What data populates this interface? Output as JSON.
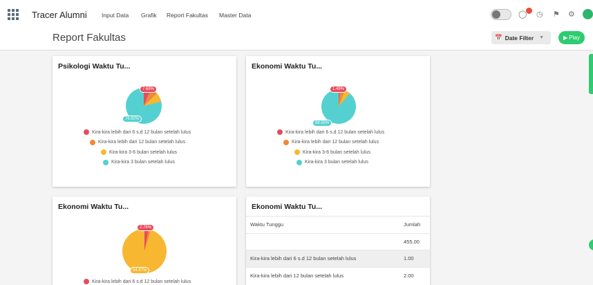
{
  "app": {
    "title": "Tracer Alumni",
    "nav": [
      "Input Data",
      "Grafik",
      "Report Fakultas",
      "Master Data"
    ]
  },
  "page": {
    "title": "Report Fakultas",
    "date_filter": "Date Filter",
    "play": "Play"
  },
  "legend": [
    {
      "label": "Kira-kira lebih dari 6 s.d 12 bulan setelah lulus",
      "color": "#e74c5c"
    },
    {
      "label": "Kira-kira lebih dari 12 bulan setelah lulus",
      "color": "#f0883a"
    },
    {
      "label": "Kira-kira 3-6 bulan setelah lulus",
      "color": "#f7b731"
    },
    {
      "label": "Kira-kira 3 bulan setelah  lulus",
      "color": "#55d0d0"
    }
  ],
  "cards": [
    {
      "title": "Psikologi Waktu Tu...",
      "top_pct": "7.69%",
      "main_pct": "76.92%"
    },
    {
      "title": "Ekonomi Waktu Tu...",
      "top_pct": "1.49%",
      "main_pct": "89.55%"
    },
    {
      "title": "Ekonomi Waktu Tu...",
      "top_pct": "2.76%",
      "main_pct": "94.47%",
      "legend_partial": "Kira-kira lebih dari 6 s.d 12 bulan setelah lulus"
    },
    {
      "title": "Ekonomi Waktu Tu..."
    }
  ],
  "table": {
    "headers": [
      "Waktu Tunggu",
      "Jumlah"
    ],
    "rows": [
      [
        "",
        "455.00"
      ],
      [
        "Kira-kira lebih dari 6 s.d 12 bulan setelah lulus",
        "1.00"
      ],
      [
        "Kira-kira lebih dari 12 bulan setelah lulus",
        "2.00"
      ]
    ]
  },
  "chart_data": [
    {
      "type": "pie",
      "title": "Psikologi Waktu Tu...",
      "categories": [
        "Kira-kira lebih dari 6 s.d 12 bulan setelah lulus",
        "Kira-kira lebih dari 12 bulan setelah lulus",
        "Kira-kira 3-6 bulan setelah lulus",
        "Kira-kira 3 bulan setelah  lulus"
      ],
      "values": [
        7.69,
        7.69,
        7.69,
        76.92
      ]
    },
    {
      "type": "pie",
      "title": "Ekonomi Waktu Tu...",
      "categories": [
        "Kira-kira lebih dari 6 s.d 12 bulan setelah lulus",
        "Kira-kira lebih dari 12 bulan setelah lulus",
        "Kira-kira 3-6 bulan setelah lulus",
        "Kira-kira 3 bulan setelah  lulus"
      ],
      "values": [
        1.49,
        4.48,
        4.48,
        89.55
      ]
    },
    {
      "type": "pie",
      "title": "Ekonomi Waktu Tu...",
      "categories": [
        "Kira-kira lebih dari 6 s.d 12 bulan setelah lulus",
        "Kira-kira lebih dari 12 bulan setelah lulus",
        "Kira-kira 3-6 bulan setelah lulus"
      ],
      "values": [
        2.76,
        2.77,
        94.47
      ]
    }
  ]
}
